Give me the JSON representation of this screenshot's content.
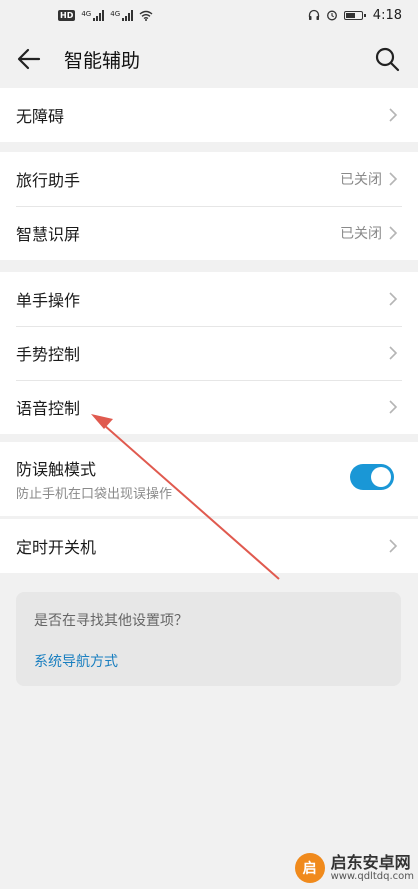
{
  "status_bar": {
    "hd_badge": "HD",
    "network_tags": [
      "4G",
      "4G"
    ],
    "time": "4:18",
    "icons": [
      "wifi-icon",
      "headphones-icon",
      "alarm-icon",
      "battery-icon"
    ]
  },
  "app_bar": {
    "title": "智能辅助",
    "back_icon": "arrow-left-icon",
    "search_icon": "search-icon"
  },
  "groups": [
    {
      "items": [
        {
          "label": "无障碍",
          "value": ""
        }
      ]
    },
    {
      "items": [
        {
          "label": "旅行助手",
          "value": "已关闭"
        },
        {
          "label": "智慧识屏",
          "value": "已关闭"
        }
      ]
    },
    {
      "items": [
        {
          "label": "单手操作",
          "value": ""
        },
        {
          "label": "手势控制",
          "value": ""
        },
        {
          "label": "语音控制",
          "value": ""
        }
      ]
    },
    {
      "items": [
        {
          "label": "防误触模式",
          "sublabel": "防止手机在口袋出现误操作",
          "toggle_on": true
        }
      ]
    },
    {
      "items": [
        {
          "label": "定时开关机",
          "value": ""
        }
      ]
    }
  ],
  "suggestion": {
    "question": "是否在寻找其他设置项？",
    "link": "系统导航方式"
  },
  "colors": {
    "accent": "#1a97d6",
    "link": "#1a7fc0",
    "annotation_arrow": "#e05a4f",
    "background": "#f1f1f1"
  },
  "watermark": {
    "logo_text": "启",
    "title": "启东安卓网",
    "url": "www.qdltdq.com"
  }
}
